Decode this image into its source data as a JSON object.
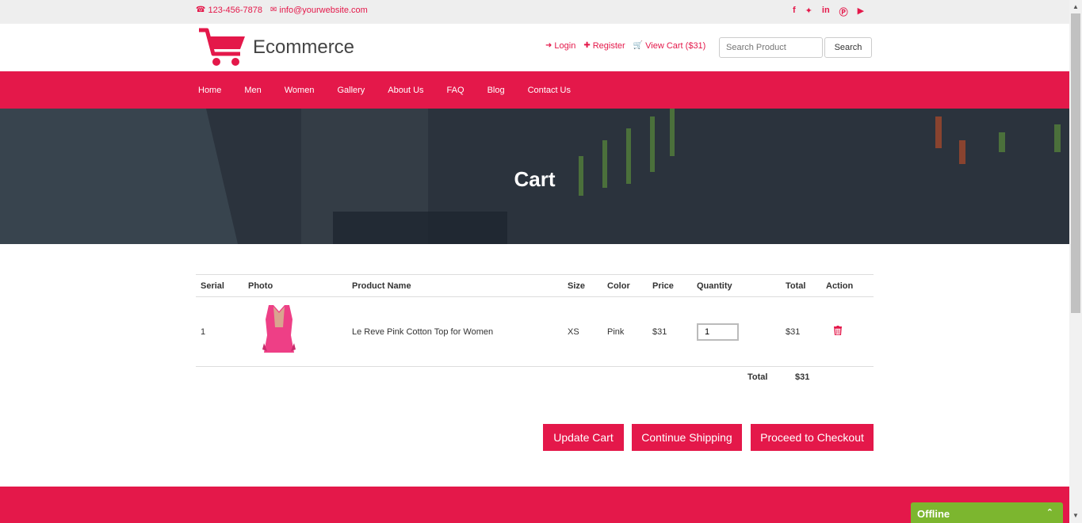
{
  "topbar": {
    "phone": "123-456-7878",
    "email": "info@yourwebsite.com",
    "social": [
      "facebook-icon",
      "twitter-icon",
      "linkedin-icon",
      "pinterest-icon",
      "youtube-icon"
    ]
  },
  "header": {
    "logo_text": "Ecommerce",
    "login": "Login",
    "register": "Register",
    "view_cart": "View Cart ($31)",
    "search_placeholder": "Search Product",
    "search_button": "Search"
  },
  "nav": {
    "items": [
      "Home",
      "Men",
      "Women",
      "Gallery",
      "About Us",
      "FAQ",
      "Blog",
      "Contact Us"
    ]
  },
  "banner": {
    "title": "Cart"
  },
  "table": {
    "headers": [
      "Serial",
      "Photo",
      "Product Name",
      "Size",
      "Color",
      "Price",
      "Quantity",
      "Total",
      "Action"
    ],
    "rows": [
      {
        "serial": "1",
        "product_name": "Le Reve Pink Cotton Top for Women",
        "size": "XS",
        "color": "Pink",
        "price": "$31",
        "quantity": "1",
        "total": "$31"
      }
    ],
    "total_label": "Total",
    "total_value": "$31"
  },
  "buttons": {
    "update": "Update Cart",
    "continue": "Continue Shipping",
    "checkout": "Proceed to Checkout"
  },
  "chat": {
    "status": "Offline"
  },
  "colors": {
    "accent": "#e4184a",
    "chat": "#7cb62f"
  }
}
